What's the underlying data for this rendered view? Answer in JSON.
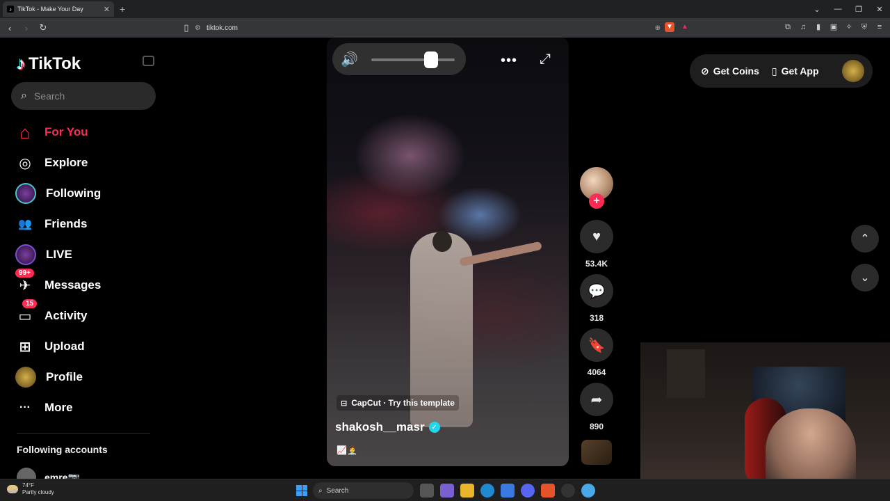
{
  "browser": {
    "tab_title": "TikTok - Make Your Day",
    "tab_close": "✕",
    "new_tab": "+",
    "url": "tiktok.com",
    "window_controls": [
      "⌄",
      "—",
      "❐",
      "✕"
    ]
  },
  "tiktok": {
    "logo_text": "TikTok",
    "search_placeholder": "Search",
    "nav": [
      {
        "label": "For You",
        "icon": "home-icon",
        "glyph": "⌂"
      },
      {
        "label": "Explore",
        "icon": "compass-icon",
        "glyph": "◎"
      },
      {
        "label": "Following",
        "icon": "following-avatar-icon",
        "glyph": ""
      },
      {
        "label": "Friends",
        "icon": "friends-icon",
        "glyph": "👥"
      },
      {
        "label": "LIVE",
        "icon": "live-avatar-icon",
        "glyph": ""
      },
      {
        "label": "Messages",
        "icon": "messages-icon",
        "glyph": "✈",
        "badge": "99+"
      },
      {
        "label": "Activity",
        "icon": "activity-icon",
        "glyph": "▭",
        "badge": "15"
      },
      {
        "label": "Upload",
        "icon": "upload-icon",
        "glyph": "⊞"
      },
      {
        "label": "Profile",
        "icon": "profile-avatar-icon",
        "glyph": ""
      },
      {
        "label": "More",
        "icon": "more-icon",
        "glyph": "···"
      }
    ],
    "following_title": "Following accounts",
    "following_users": [
      {
        "name": "emre📷"
      }
    ]
  },
  "video": {
    "template_label": "CapCut · Try this template",
    "author": "shakosh__masr",
    "caption_emoji": "📈👩‍⚕️",
    "volume_level": 0.72,
    "likes": "53.4K",
    "comments": "318",
    "bookmarks": "4064",
    "shares": "890"
  },
  "top_right": {
    "get_coins": "Get Coins",
    "get_app": "Get App"
  },
  "taskbar": {
    "temperature": "74°F",
    "weather": "Partly cloudy",
    "search_label": "Search"
  },
  "colors": {
    "accent": "#fe2c55",
    "verified": "#20d5ec"
  }
}
